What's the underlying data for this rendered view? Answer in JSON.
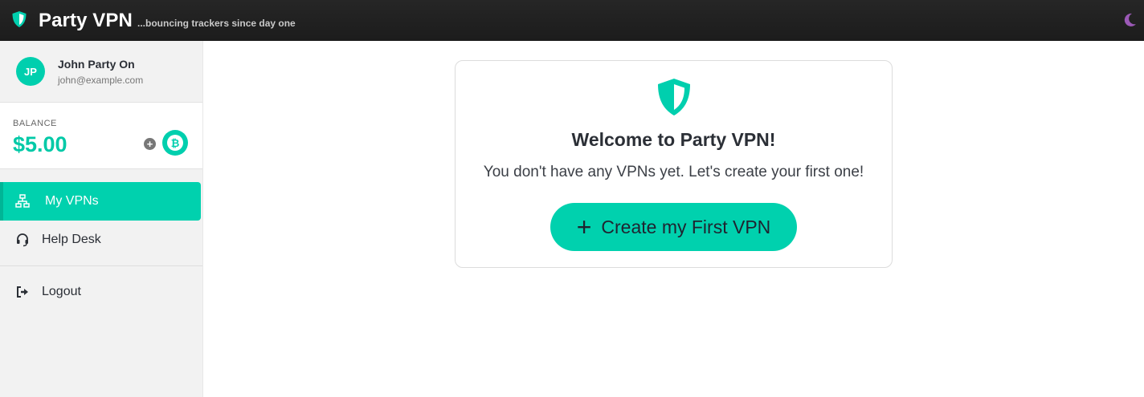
{
  "header": {
    "app_name": "Party VPN",
    "tagline": "...bouncing trackers since day one",
    "brand_icon": "shield-icon",
    "theme_icon": "moon-icon",
    "accent_color": "#00cfae",
    "theme_icon_color": "#9b59b6"
  },
  "user": {
    "initials": "JP",
    "name": "John Party On",
    "email": "john@example.com"
  },
  "balance": {
    "label": "BALANCE",
    "value": "$5.00",
    "add_icon": "plus-circle-icon",
    "crypto_icon": "bitcoin-icon",
    "crypto_symbol": "₿"
  },
  "nav": {
    "items": [
      {
        "label": "My VPNs",
        "icon": "network-icon",
        "active": true
      },
      {
        "label": "Help Desk",
        "icon": "headset-icon",
        "active": false
      },
      {
        "label": "Logout",
        "icon": "logout-icon",
        "active": false
      }
    ]
  },
  "main": {
    "card_icon": "shield-icon",
    "title": "Welcome to Party VPN!",
    "subtitle": "You don't have any VPNs yet. Let's create your first one!",
    "cta_icon": "+",
    "cta_label": "Create my First VPN"
  }
}
